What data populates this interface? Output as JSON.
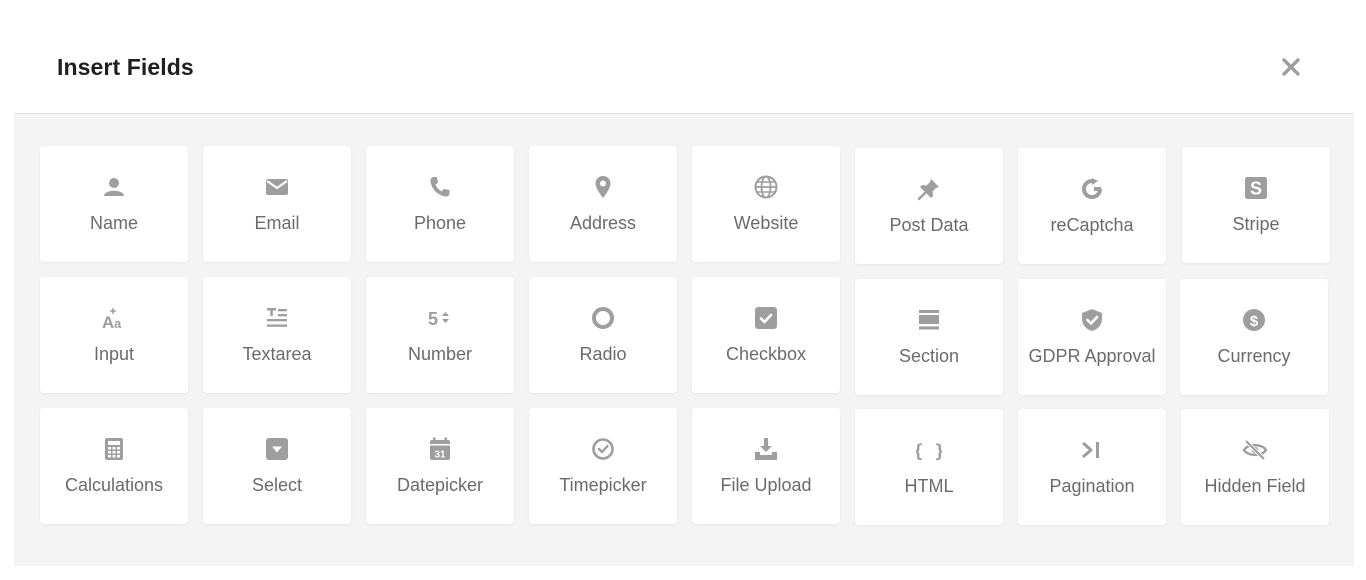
{
  "modal": {
    "title": "Insert Fields"
  },
  "colors": {
    "icon": "#9e9e9e",
    "label": "#6b6b6b",
    "body_bg": "#f4f4f4",
    "card_bg": "#ffffff"
  },
  "fields": [
    {
      "label": "Name",
      "icon": "person-icon"
    },
    {
      "label": "Email",
      "icon": "envelope-icon"
    },
    {
      "label": "Phone",
      "icon": "phone-icon"
    },
    {
      "label": "Address",
      "icon": "map-pin-icon"
    },
    {
      "label": "Website",
      "icon": "globe-icon"
    },
    {
      "label": "Post Data",
      "icon": "pushpin-icon"
    },
    {
      "label": "reCaptcha",
      "icon": "recaptcha-icon"
    },
    {
      "label": "Stripe",
      "icon": "stripe-icon"
    },
    {
      "label": "Input",
      "icon": "text-input-icon"
    },
    {
      "label": "Textarea",
      "icon": "textarea-icon"
    },
    {
      "label": "Number",
      "icon": "number-stepper-icon"
    },
    {
      "label": "Radio",
      "icon": "radio-icon"
    },
    {
      "label": "Checkbox",
      "icon": "checkbox-icon"
    },
    {
      "label": "Section",
      "icon": "section-icon"
    },
    {
      "label": "GDPR Approval",
      "icon": "shield-check-icon"
    },
    {
      "label": "Currency",
      "icon": "dollar-icon"
    },
    {
      "label": "Calculations",
      "icon": "calculator-icon"
    },
    {
      "label": "Select",
      "icon": "select-dropdown-icon"
    },
    {
      "label": "Datepicker",
      "icon": "calendar-icon"
    },
    {
      "label": "Timepicker",
      "icon": "clock-icon"
    },
    {
      "label": "File Upload",
      "icon": "upload-icon"
    },
    {
      "label": "HTML",
      "icon": "braces-icon"
    },
    {
      "label": "Pagination",
      "icon": "pagination-icon"
    },
    {
      "label": "Hidden Field",
      "icon": "eye-slash-icon"
    }
  ]
}
